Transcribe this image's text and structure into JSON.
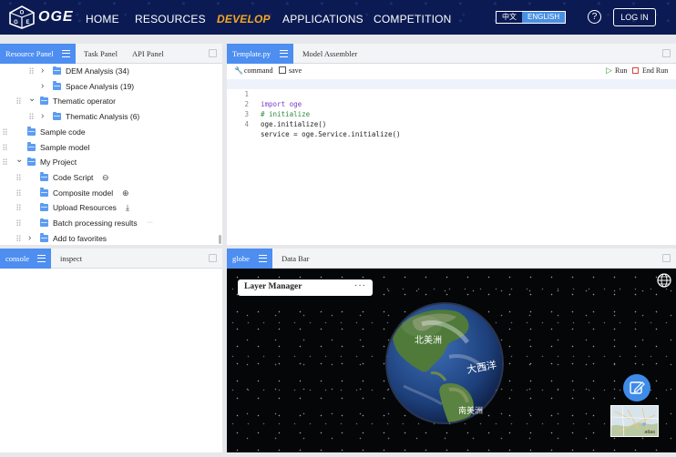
{
  "app": {
    "brand": "OGE",
    "logo_letters": [
      "O",
      "G",
      "E"
    ]
  },
  "nav": {
    "items": [
      {
        "label": "HOME",
        "active": false
      },
      {
        "label": "RESOURCES",
        "active": false
      },
      {
        "label": "DEVELOP",
        "active": true
      },
      {
        "label": "APPLICATIONS",
        "active": false
      },
      {
        "label": "COMPETITION",
        "active": false
      }
    ],
    "lang": {
      "zh": "中文",
      "en": "ENGLISH",
      "selected": "ENGLISH"
    },
    "help_glyph": "?",
    "login_label": "LOG IN"
  },
  "colors": {
    "nav_bg": "#0b1a52",
    "accent": "#4d8ef0",
    "active_nav": "#f5a623"
  },
  "resource_panel": {
    "tabs": [
      "Resource Panel",
      "Task Panel",
      "API Panel"
    ],
    "tree": [
      {
        "label": "DEM Analysis (34)",
        "indent": 3,
        "chevron": ">",
        "folder": true,
        "grip": true
      },
      {
        "label": "Space Analysis (19)",
        "indent": 3,
        "chevron": ">",
        "folder": true,
        "grip": false
      },
      {
        "label": "Thematic operator",
        "indent": 2,
        "chevron": "v",
        "folder": true,
        "grip": true
      },
      {
        "label": "Thematic Analysis (6)",
        "indent": 3,
        "chevron": ">",
        "folder": true,
        "grip": true
      },
      {
        "label": "Sample code",
        "indent": 1,
        "chevron": "",
        "folder": true,
        "grip": true
      },
      {
        "label": "Sample model",
        "indent": 1,
        "chevron": "",
        "folder": true,
        "grip": true
      },
      {
        "label": "My Project",
        "indent": 1,
        "chevron": "v",
        "folder": true,
        "grip": true
      },
      {
        "label": "Code Script",
        "indent": 2,
        "chevron": "",
        "folder": true,
        "grip": true,
        "icon": "minus-circle-icon"
      },
      {
        "label": "Composite model",
        "indent": 2,
        "chevron": "",
        "folder": true,
        "grip": true,
        "icon": "plus-circle-icon"
      },
      {
        "label": "Upload Resources",
        "indent": 2,
        "chevron": "",
        "folder": true,
        "grip": true,
        "icon": "upload-icon"
      },
      {
        "label": "Batch processing results",
        "indent": 2,
        "chevron": "",
        "folder": true,
        "grip": true,
        "icon": "more-icon"
      },
      {
        "label": "Add to favorites",
        "indent": 2,
        "chevron": ">",
        "folder": true,
        "grip": true
      }
    ]
  },
  "editor": {
    "tabs": [
      "Template.py",
      "Model Assembler"
    ],
    "toolbar": {
      "command": "command",
      "save": "save",
      "run": "Run",
      "end_run": "End Run"
    },
    "code": [
      {
        "line": "1",
        "text": "import oge",
        "kind": "import"
      },
      {
        "line": "2",
        "text": "# initialize",
        "kind": "comment"
      },
      {
        "line": "3",
        "text": "oge.initialize()",
        "kind": "code"
      },
      {
        "line": "4",
        "text": "service = oge.Service.initialize()",
        "kind": "code"
      }
    ]
  },
  "console_panel": {
    "tabs": [
      "console",
      "inspect"
    ]
  },
  "globe_panel": {
    "tabs": [
      "globe",
      "Data Bar"
    ],
    "layer_manager": {
      "title": "Layer Manager",
      "more": "···"
    },
    "globe_labels": [
      "北美洲",
      "大西洋",
      "南美洲"
    ],
    "minimap_label": "atlas"
  }
}
